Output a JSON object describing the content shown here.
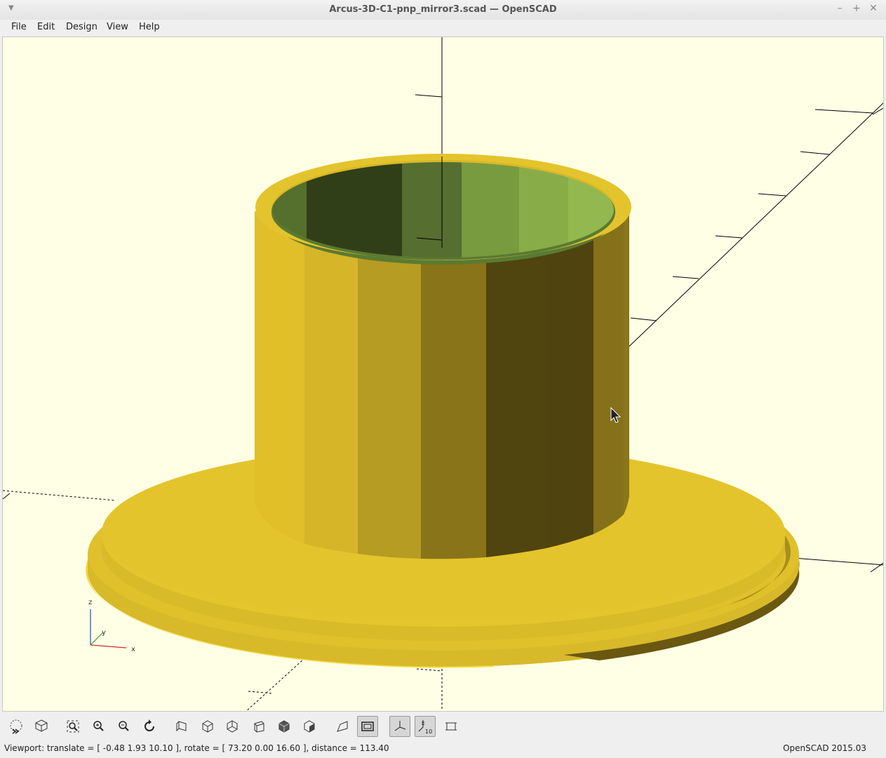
{
  "window": {
    "title": "Arcus-3D-C1-pnp_mirror3.scad — OpenSCAD",
    "controls": [
      "–",
      "+",
      "✕"
    ]
  },
  "menu": [
    "File",
    "Edit",
    "Design",
    "View",
    "Help"
  ],
  "axes": {
    "x": "x",
    "y": "y",
    "z": "z"
  },
  "toolbar": {
    "buttons": [
      {
        "name": "preview-button",
        "icon": "preview-icon"
      },
      {
        "name": "render-button",
        "icon": "render-icon"
      },
      {
        "name": "view-all-button",
        "icon": "view-all-icon"
      },
      {
        "name": "zoom-in-button",
        "icon": "zoom-in-icon"
      },
      {
        "name": "zoom-out-button",
        "icon": "zoom-out-icon"
      },
      {
        "name": "reset-view-button",
        "icon": "reset-view-icon"
      },
      {
        "name": "view-right-button",
        "icon": "view-right-icon"
      },
      {
        "name": "view-top-button",
        "icon": "view-top-icon"
      },
      {
        "name": "view-bottom-button",
        "icon": "view-bottom-icon"
      },
      {
        "name": "view-left-button",
        "icon": "view-left-icon"
      },
      {
        "name": "view-front-button",
        "icon": "view-front-icon"
      },
      {
        "name": "view-back-button",
        "icon": "view-back-icon"
      },
      {
        "name": "perspective-button",
        "icon": "perspective-icon"
      },
      {
        "name": "orthogonal-button",
        "icon": "orthogonal-icon",
        "active": true
      },
      {
        "name": "show-axes-button",
        "icon": "axes-icon",
        "active": true
      },
      {
        "name": "show-scale-button",
        "icon": "scale-markers-icon",
        "active": true
      },
      {
        "name": "show-edges-button",
        "icon": "edges-icon"
      }
    ],
    "scale_marker_label": "10"
  },
  "status": {
    "viewport": "Viewport: translate = [ -0.48 1.93 10.10 ], rotate = [ 73.20 0.00 16.60 ], distance = 113.40",
    "version": "OpenSCAD 2015.03"
  },
  "colors": {
    "viewport_bg": "#ffffe5",
    "model": "#e3c32b",
    "model_inner": "#5a7a32"
  }
}
